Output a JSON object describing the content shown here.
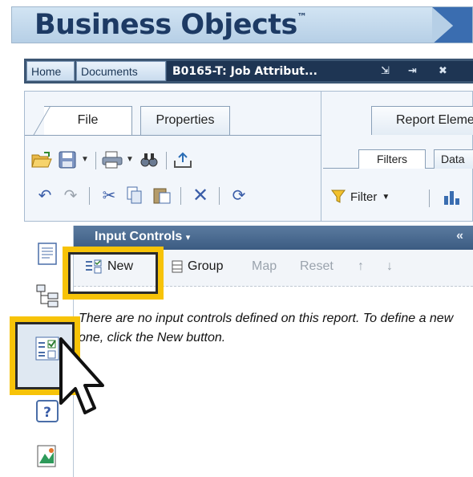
{
  "brand": {
    "name": "Business Objects",
    "trademark": "™"
  },
  "nav": {
    "home": "Home",
    "documents": "Documents",
    "doc_tab": "B0165-T: Job Attribut...",
    "pin": "⇲",
    "minimize": "⇥",
    "close": "✖"
  },
  "ribbon": {
    "tabs": [
      "File",
      "Properties"
    ],
    "right_tab": "Report Elemen",
    "subtabs": [
      "Filters",
      "Data"
    ],
    "filter_label": "Filter"
  },
  "input_controls": {
    "title": "Input Controls",
    "title_arrow": "▾",
    "collapse": "«",
    "buttons": {
      "new": "New",
      "group": "Group",
      "map": "Map",
      "reset": "Reset",
      "up": "↑",
      "down": "↓"
    },
    "message": "There are no input controls defined on this report. To define a new one, click the New button."
  },
  "colors": {
    "highlight": "#f7c308",
    "header_dark": "#1e3553",
    "panel_header": "#3b5b82"
  },
  "icons": [
    "open-folder-icon",
    "save-icon",
    "print-icon",
    "find-icon",
    "export-icon",
    "undo-icon",
    "redo-icon",
    "cut-icon",
    "copy-icon",
    "paste-icon",
    "delete-icon",
    "refresh-icon",
    "filter-icon",
    "ranking-icon",
    "document-structure-icon",
    "hierarchy-icon",
    "input-controls-icon",
    "help-icon",
    "chart-icon",
    "cursor-icon"
  ]
}
